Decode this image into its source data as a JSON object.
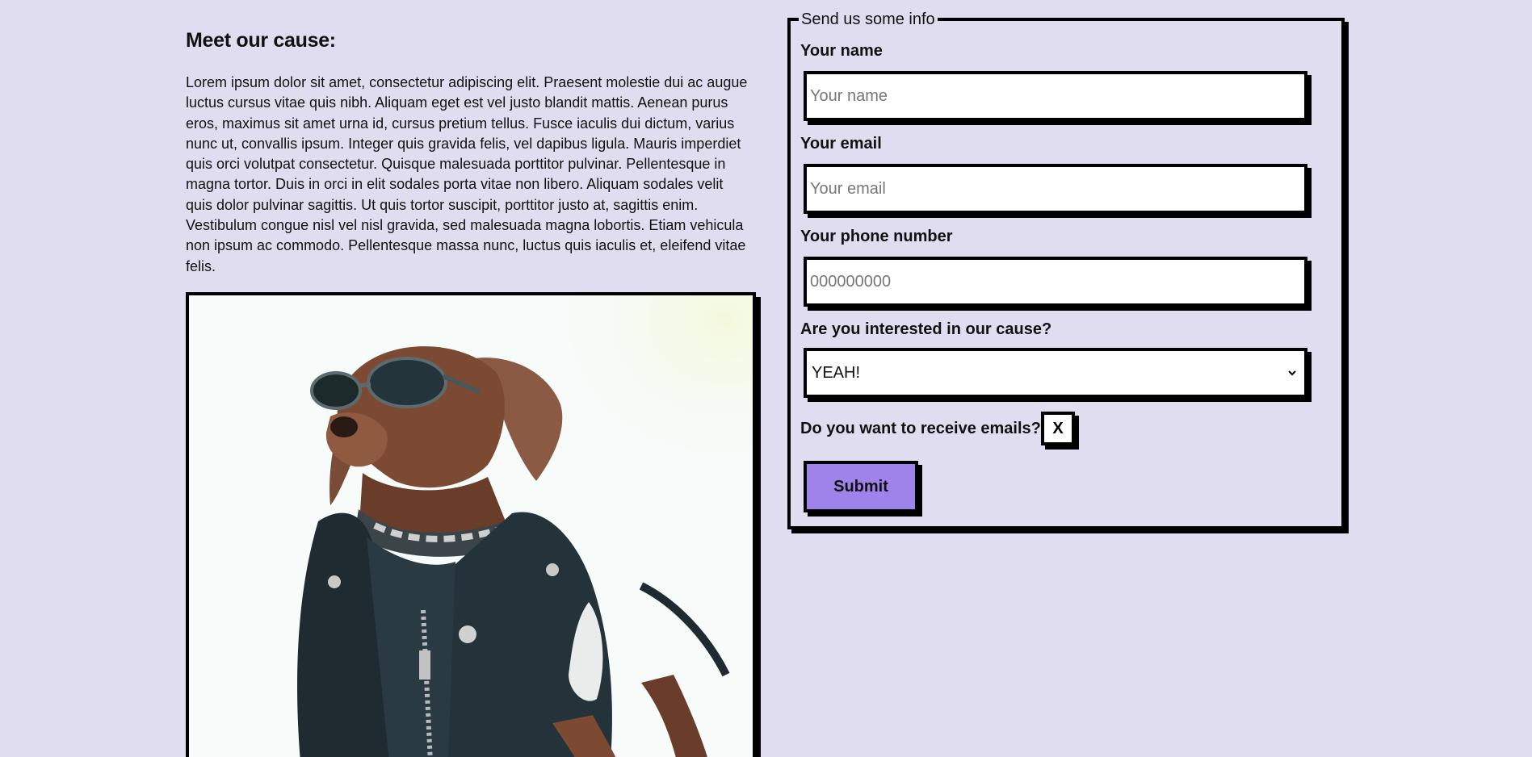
{
  "article": {
    "heading": "Meet our cause:",
    "body": "Lorem ipsum dolor sit amet, consectetur adipiscing elit. Praesent molestie dui ac augue luctus cursus vitae quis nibh. Aliquam eget est vel justo blandit mattis. Aenean purus eros, maximus sit amet urna id, cursus pretium tellus. Fusce iaculis dui dictum, varius nunc ut, convallis ipsum. Integer quis gravida felis, vel dapibus ligula. Mauris imperdiet quis orci volutpat consectetur. Quisque malesuada porttitor pulvinar. Pellentesque in magna tortor. Duis in orci in elit sodales porta vitae non libero. Aliquam sodales velit quis dolor pulvinar sagittis. Ut quis tortor suscipit, porttitor justo at, sagittis enim. Vestibulum congue nisl vel nisl gravida, sed malesuada magna lobortis. Etiam vehicula non ipsum ac commodo. Pellentesque massa nunc, luctus quis iaculis et, eleifend vitae felis."
  },
  "form": {
    "legend": "Send us some info",
    "name": {
      "label": "Your name",
      "value": "",
      "placeholder": "Your name"
    },
    "email": {
      "label": "Your email",
      "value": "",
      "placeholder": "Your email"
    },
    "phone": {
      "label": "Your phone number",
      "value": "",
      "placeholder": "000000000"
    },
    "interest": {
      "label": "Are you interested in our cause?",
      "selected": "YEAH!"
    },
    "emails_opt_in": {
      "label": "Do you want to receive emails?",
      "mark": "X"
    },
    "submit_label": "Submit"
  },
  "colors": {
    "page_background": "#e1ddf0",
    "submit_button": "#a083ea",
    "border": "#000000"
  },
  "icons": {
    "select_arrow": "chevron-down-icon"
  }
}
